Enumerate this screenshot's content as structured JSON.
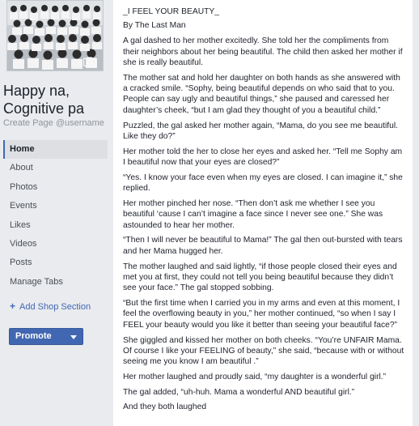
{
  "sidebar": {
    "page_name": "Happy na, Cognitive pa",
    "create_handle": "Create Page @username",
    "nav": [
      {
        "label": "Home",
        "active": true
      },
      {
        "label": "About"
      },
      {
        "label": "Photos"
      },
      {
        "label": "Events"
      },
      {
        "label": "Likes"
      },
      {
        "label": "Videos"
      },
      {
        "label": "Posts"
      },
      {
        "label": "Manage Tabs"
      }
    ],
    "add_shop_label": "Add Shop Section",
    "promote_label": "Promote"
  },
  "post": {
    "title": "_I FEEL YOUR BEAUTY_",
    "author": "By The Last Man",
    "paragraphs": [
      "A gal dashed to her mother excitedly. She told her the compliments from their neighbors about her being beautiful. The child then asked her mother if she is really beautiful.",
      "The mother sat and hold her daughter on both hands as she answered with a cracked smile. “Sophy, being beautiful depends on who said that to you. People can say ugly and beautiful things,” she paused and caressed her daughter’s cheek, “but I am glad they thought of you a beautiful child.”",
      "Puzzled, the gal asked her mother again, “Mama, do you see me beautiful. Like they do?”",
      "Her mother told the her to close her eyes and asked her. “Tell me Sophy am I beautiful now that your eyes are closed?”",
      "“Yes. I know your face even when my eyes are closed. I can imagine it,” she replied.",
      "Her mother pinched her nose. “Then don’t ask me whether I see you beautiful ‘cause I can’t imagine a face since I never see one.” She was astounded to hear her mother.",
      "“Then I will never be beautiful to Mama!” The gal then out-bursted with tears and her Mama hugged her.",
      "The mother laughed and said lightly, “if those people closed their eyes and met you at first, they could not tell you being beautiful because they didn’t see your face.” The gal stopped sobbing.",
      "“But the first time when I carried you in my arms and even at this moment, I feel the overflowing beauty in you,” her mother continued, “so when I say I FEEL your beauty would you like it better than seeing your beautiful face?”",
      "She giggled and kissed her mother on both cheeks. “You’re UNFAIR Mama. Of course I like your FEELING of beauty,” she said, “because with or without seeing me you know I am beautiful .”",
      "Her mother laughed and proudly said, “my daughter is a wonderful girl.”",
      "The gal added, “uh-huh. Mama a wonderful AND beautiful girl.”",
      "And they both laughed"
    ]
  },
  "icons": {
    "cover": "group-photo-image",
    "camera": "camera-icon",
    "plus": "plus-icon",
    "caret": "caret-down-icon"
  },
  "colors": {
    "background": "#e9ebee",
    "accent": "#4267b2",
    "text": "#1d2129",
    "muted": "#90949c"
  }
}
